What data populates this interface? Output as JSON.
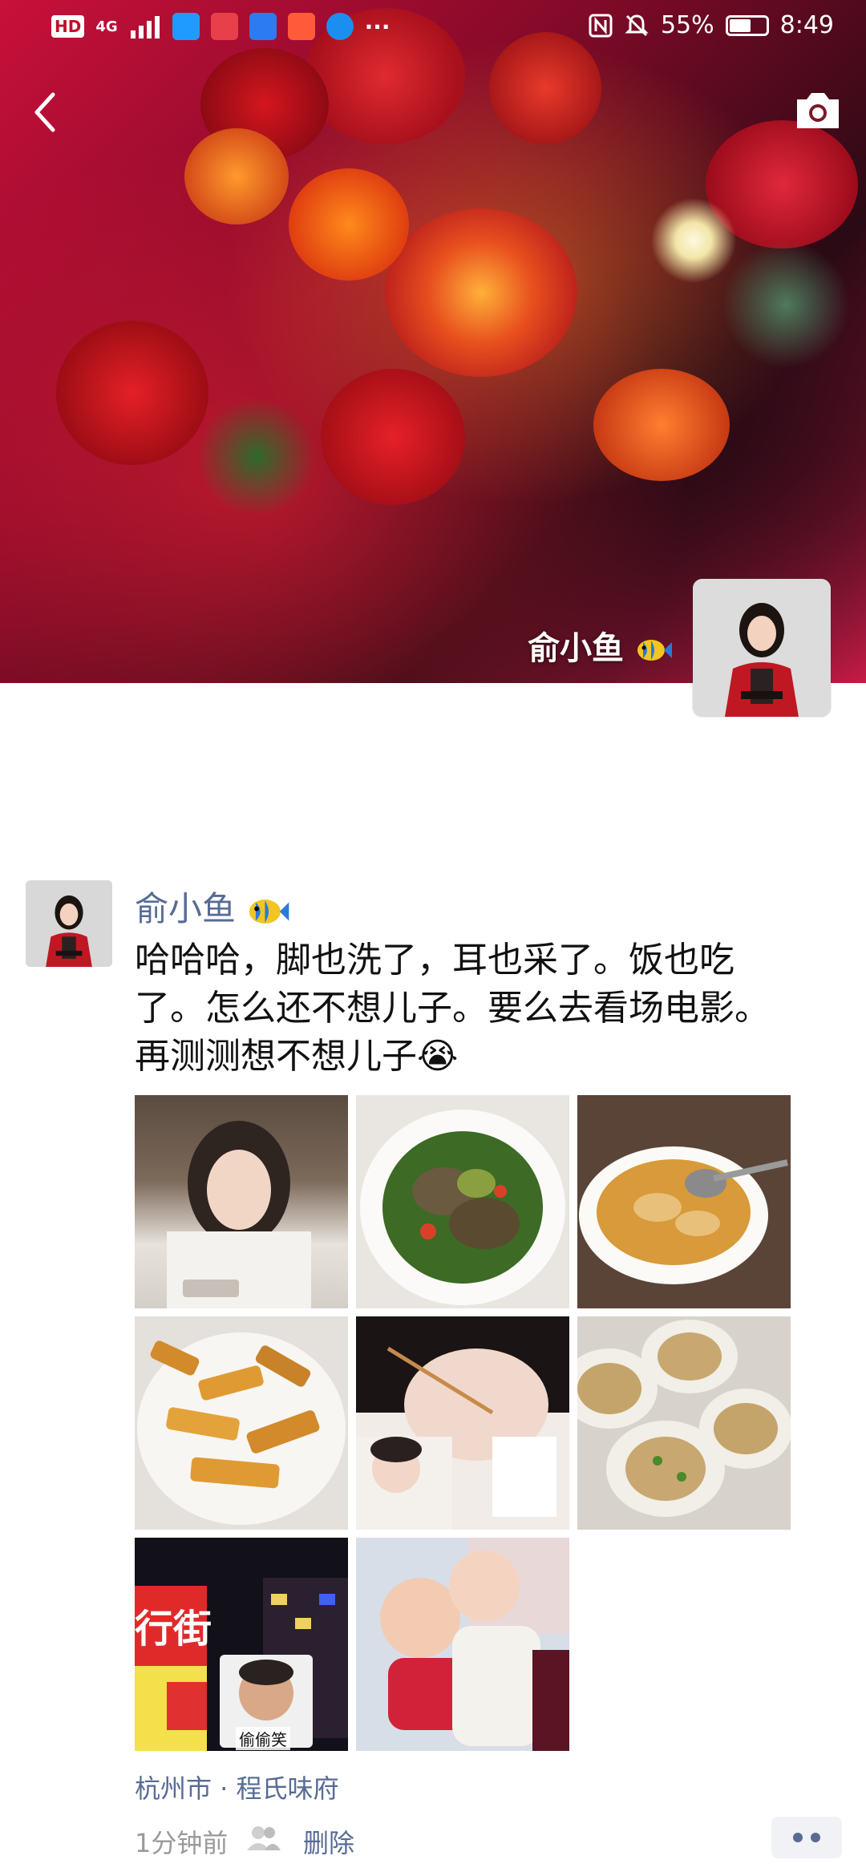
{
  "status_bar": {
    "time": "8:49",
    "battery_percent": "55%",
    "network": "4G",
    "hd_label": "HD",
    "more_dots": "···"
  },
  "cover": {
    "owner_name": "俞小鱼",
    "camera_icon": "camera-icon",
    "back_icon": "back-chevron-icon"
  },
  "post": {
    "author": "俞小鱼",
    "text_line1": "哈哈哈，脚也洗了，耳也采了。饭也吃",
    "text_line2": "了。怎么还不想儿子。要么去看场电影。",
    "text_line3": "再测测想不想儿子",
    "emoji": "😭",
    "photos": [
      {
        "alt": "girl-photo"
      },
      {
        "alt": "snail-dish-photo"
      },
      {
        "alt": "tofu-soup-photo"
      },
      {
        "alt": "fried-eggplant-photo"
      },
      {
        "alt": "ear-cleaning-photo"
      },
      {
        "alt": "scallop-photo"
      },
      {
        "alt": "street-night-photo",
        "sticker_text": "偷偷笑"
      },
      {
        "alt": "babies-photo"
      }
    ],
    "location": "杭州市 · 程氏味府",
    "time_ago": "1分钟前",
    "delete_label": "删除",
    "street_sign": "行街"
  },
  "colors": {
    "link": "#576b95",
    "text": "#111111",
    "muted": "#9a9a9a"
  }
}
